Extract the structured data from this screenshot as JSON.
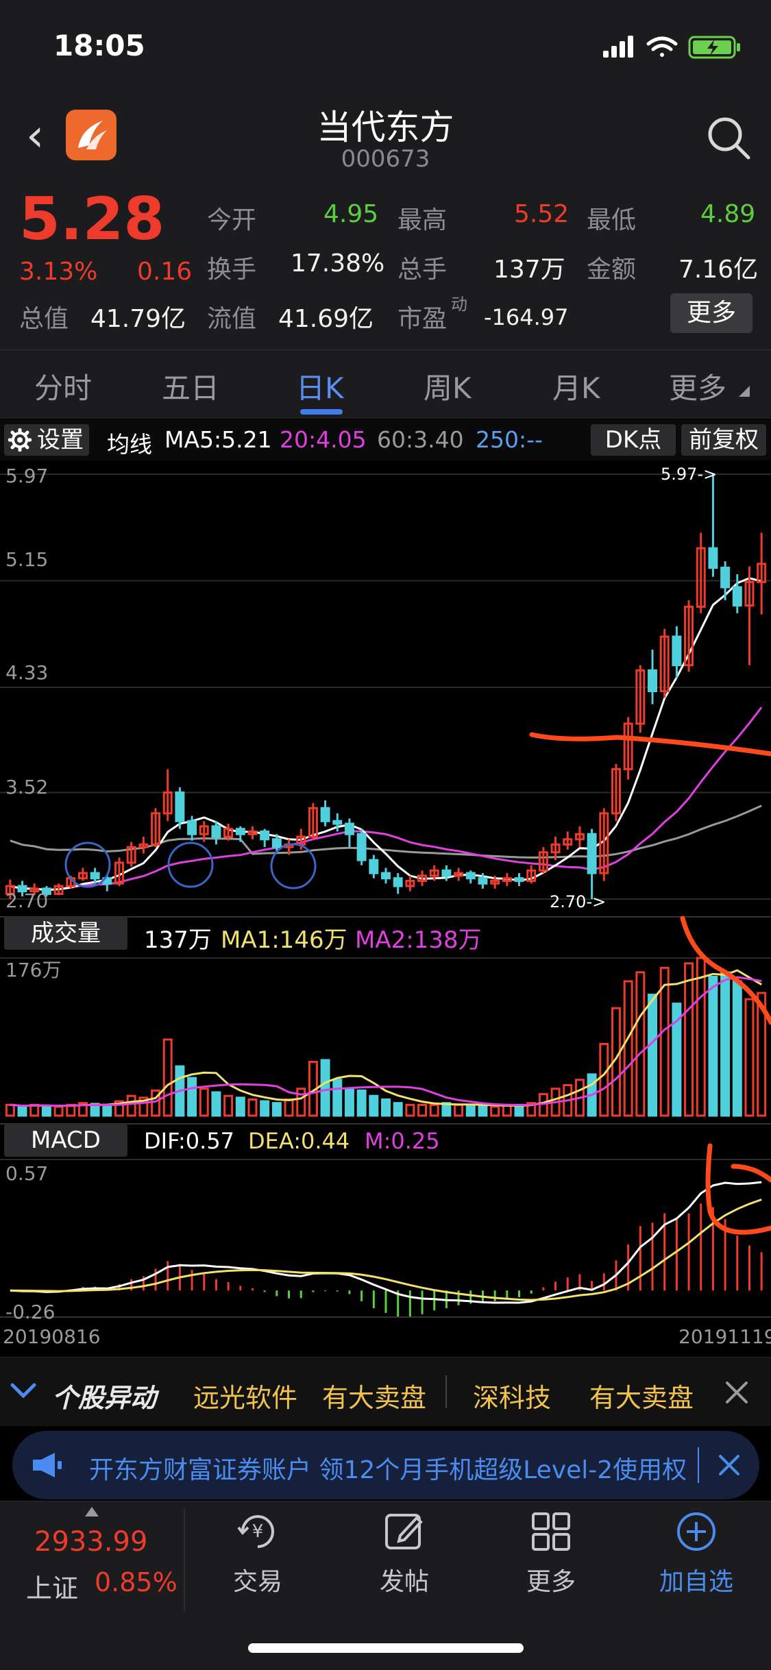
{
  "status": {
    "time": "18:05"
  },
  "header": {
    "name": "当代东方",
    "code": "000673"
  },
  "quote": {
    "price": "5.28",
    "pct": "3.13%",
    "change": "0.16",
    "open_label": "今开",
    "open": "4.95",
    "high_label": "最高",
    "high": "5.52",
    "low_label": "最低",
    "low": "4.89",
    "turnover_label": "换手",
    "turnover": "17.38%",
    "volume_label": "总手",
    "volume": "137万",
    "amount_label": "金额",
    "amount": "7.16亿",
    "mktcap_label": "总值",
    "mktcap": "41.79亿",
    "float_label": "流值",
    "float": "41.69亿",
    "pe_label": "市盈",
    "pe_sup": "动",
    "pe": "-164.97",
    "more": "更多"
  },
  "tabs": [
    {
      "label": "分时"
    },
    {
      "label": "五日"
    },
    {
      "label": "日K"
    },
    {
      "label": "周K"
    },
    {
      "label": "月K"
    },
    {
      "label": "更多"
    }
  ],
  "chart_toolbar": {
    "settings": "设置",
    "ma_title": "均线",
    "ma5": "MA5:5.21",
    "ma20": "20:4.05",
    "ma60": "60:3.40",
    "ma250": "250:--",
    "dk": "DK点",
    "fq": "前复权"
  },
  "price_axis": {
    "y1": "5.97",
    "y2": "5.15",
    "y3": "4.33",
    "y4": "3.52",
    "y5": "2.70",
    "max_marker": "5.97->",
    "min_marker": "2.70->"
  },
  "volume_bar": {
    "label": "成交量",
    "vol": "137万",
    "ma1": "MA1:146万",
    "ma2": "MA2:138万",
    "axis": "176万"
  },
  "macd_bar": {
    "label": "MACD",
    "dif": "DIF:0.57",
    "dea": "DEA:0.44",
    "m": "M:0.25",
    "axis_top": "0.57",
    "axis_bottom": "-0.26"
  },
  "dates": {
    "start": "20190816",
    "end": "20191119"
  },
  "ticker": {
    "title": "个股异动",
    "s1": "远光软件",
    "a1": "有大卖盘",
    "s2": "深科技",
    "a2": "有大卖盘"
  },
  "banner": {
    "text": "开东方财富证券账户 领12个月手机超级Level-2使用权"
  },
  "tabbar": {
    "index_value": "2933.99",
    "index_name": "上证",
    "index_pct": "0.85%",
    "trade": "交易",
    "post": "发帖",
    "more": "更多",
    "add": "加自选"
  },
  "colors": {
    "up": "#ef3b2c",
    "down": "#4fd0dc",
    "ma5": "#ffffff",
    "ma20": "#e040e0",
    "ma60": "#9a9a9a",
    "ma250": "#5aa0f0",
    "accent": "#3f7ee8",
    "annotation": "#ff4a1c"
  },
  "chart_data": {
    "type": "candlestick",
    "x_range": [
      "20190816",
      "20191119"
    ],
    "y_ticks": [
      5.97,
      5.15,
      4.33,
      3.52,
      2.7
    ],
    "candles": [
      [
        2.74,
        2.8,
        2.85,
        2.7
      ],
      [
        2.8,
        2.76,
        2.84,
        2.72
      ],
      [
        2.76,
        2.78,
        2.82,
        2.73
      ],
      [
        2.78,
        2.74,
        2.8,
        2.72
      ],
      [
        2.74,
        2.8,
        2.82,
        2.73
      ],
      [
        2.8,
        2.86,
        2.88,
        2.78
      ],
      [
        2.86,
        2.9,
        2.94,
        2.84
      ],
      [
        2.9,
        2.86,
        2.94,
        2.82
      ],
      [
        2.86,
        2.82,
        2.88,
        2.76
      ],
      [
        2.82,
        2.98,
        3.02,
        2.8
      ],
      [
        2.98,
        3.1,
        3.14,
        2.95
      ],
      [
        3.1,
        3.12,
        3.18,
        3.05
      ],
      [
        3.12,
        3.36,
        3.4,
        3.1
      ],
      [
        3.36,
        3.52,
        3.7,
        3.3
      ],
      [
        3.52,
        3.3,
        3.56,
        3.24
      ],
      [
        3.3,
        3.2,
        3.34,
        3.15
      ],
      [
        3.2,
        3.26,
        3.3,
        3.14
      ],
      [
        3.26,
        3.18,
        3.3,
        3.12
      ],
      [
        3.18,
        3.24,
        3.28,
        3.15
      ],
      [
        3.24,
        3.2,
        3.26,
        3.14
      ],
      [
        3.2,
        3.22,
        3.26,
        3.16
      ],
      [
        3.22,
        3.16,
        3.24,
        3.1
      ],
      [
        3.16,
        3.1,
        3.2,
        3.06
      ],
      [
        3.1,
        3.12,
        3.16,
        3.04
      ],
      [
        3.12,
        3.18,
        3.24,
        3.08
      ],
      [
        3.18,
        3.4,
        3.44,
        3.16
      ],
      [
        3.4,
        3.3,
        3.46,
        3.26
      ],
      [
        3.3,
        3.28,
        3.36,
        3.22
      ],
      [
        3.28,
        3.2,
        3.32,
        3.1
      ],
      [
        3.2,
        3.0,
        3.24,
        2.96
      ],
      [
        3.0,
        2.9,
        3.04,
        2.86
      ],
      [
        2.9,
        2.86,
        2.94,
        2.82
      ],
      [
        2.86,
        2.8,
        2.9,
        2.74
      ],
      [
        2.8,
        2.84,
        2.88,
        2.76
      ],
      [
        2.84,
        2.88,
        2.92,
        2.8
      ],
      [
        2.88,
        2.92,
        2.96,
        2.84
      ],
      [
        2.92,
        2.88,
        2.96,
        2.84
      ],
      [
        2.88,
        2.9,
        2.94,
        2.84
      ],
      [
        2.9,
        2.86,
        2.92,
        2.82
      ],
      [
        2.86,
        2.82,
        2.9,
        2.78
      ],
      [
        2.82,
        2.84,
        2.88,
        2.78
      ],
      [
        2.84,
        2.86,
        2.9,
        2.8
      ],
      [
        2.86,
        2.84,
        2.9,
        2.8
      ],
      [
        2.84,
        2.92,
        2.96,
        2.82
      ],
      [
        2.92,
        3.06,
        3.1,
        2.9
      ],
      [
        3.06,
        3.12,
        3.18,
        3.0
      ],
      [
        3.12,
        3.16,
        3.22,
        3.08
      ],
      [
        3.16,
        3.2,
        3.26,
        3.1
      ],
      [
        3.2,
        2.9,
        3.24,
        2.7
      ],
      [
        2.9,
        3.36,
        3.4,
        2.84
      ],
      [
        3.36,
        3.7,
        3.74,
        3.3
      ],
      [
        3.7,
        4.05,
        4.1,
        3.62
      ],
      [
        4.05,
        4.46,
        4.5,
        3.98
      ],
      [
        4.46,
        4.3,
        4.62,
        4.2
      ],
      [
        4.3,
        4.72,
        4.78,
        4.25
      ],
      [
        4.72,
        4.5,
        4.8,
        4.4
      ],
      [
        4.5,
        4.95,
        5.0,
        4.45
      ],
      [
        4.95,
        5.4,
        5.52,
        4.9
      ],
      [
        5.4,
        5.25,
        5.97,
        5.18
      ],
      [
        5.25,
        5.1,
        5.3,
        5.0
      ],
      [
        5.1,
        4.96,
        5.2,
        4.9
      ],
      [
        4.96,
        5.14,
        5.26,
        4.5
      ],
      [
        5.14,
        5.28,
        5.52,
        4.89
      ]
    ],
    "volume_max": 176,
    "volume": [
      12,
      10,
      12,
      11,
      10,
      12,
      14,
      13,
      12,
      16,
      22,
      20,
      28,
      85,
      55,
      42,
      30,
      26,
      22,
      20,
      18,
      16,
      14,
      18,
      30,
      60,
      62,
      40,
      30,
      28,
      22,
      18,
      14,
      12,
      12,
      12,
      14,
      12,
      12,
      10,
      10,
      12,
      12,
      14,
      24,
      30,
      34,
      40,
      46,
      80,
      120,
      150,
      160,
      135,
      165,
      125,
      170,
      176,
      155,
      160,
      150,
      130,
      137
    ],
    "macd_range": [
      -0.26,
      0.57
    ]
  }
}
